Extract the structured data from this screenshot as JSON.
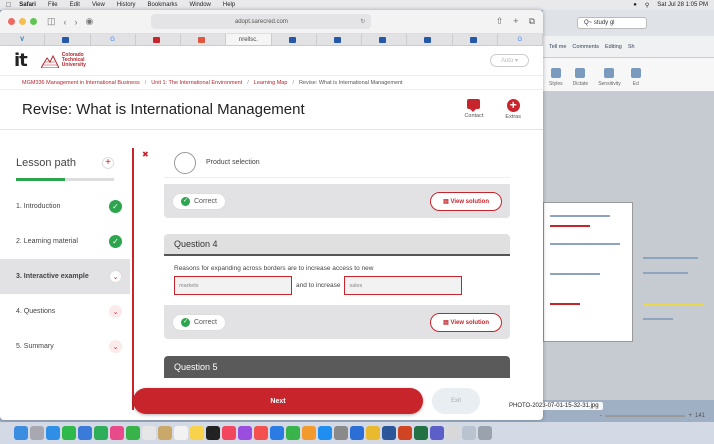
{
  "menubar": {
    "app": "Safari",
    "items": [
      "File",
      "Edit",
      "View",
      "History",
      "Bookmarks",
      "Window",
      "Help"
    ],
    "clock": "Sat Jul 28  1:05 PM"
  },
  "browser": {
    "url": "adopt.sarecred.com",
    "tabs": [
      "V",
      "",
      "G",
      "",
      "",
      "nrellsc.",
      "",
      "",
      "",
      "",
      "",
      "G"
    ]
  },
  "site": {
    "logo": "it",
    "university_name": "Colorado Technical University",
    "language_select": "Auto"
  },
  "breadcrumb": [
    "MGM336 Management in International Business",
    "Unit 1: The International Environment",
    "Learning Map",
    "Revise: What is International Management"
  ],
  "page": {
    "title": "Revise: What is International Management",
    "actions": {
      "contact": "Contact",
      "extras": "Extras"
    }
  },
  "lesson_path": {
    "title": "Lesson path",
    "progress_percent": 50,
    "items": [
      {
        "label": "1. Introduction",
        "state": "done"
      },
      {
        "label": "2. Learning material",
        "state": "done"
      },
      {
        "label": "3. Interactive example",
        "state": "current"
      },
      {
        "label": "4. Questions",
        "state": "open"
      },
      {
        "label": "5. Summary",
        "state": "open"
      }
    ]
  },
  "questions": {
    "prev": {
      "option_label": "Product selection",
      "result": "Correct",
      "view_solution": "View solution"
    },
    "q4": {
      "header": "Question 4",
      "text": "Reasons for expanding across borders are to increase access to new",
      "blank1": "markets",
      "middle": "and to increase",
      "blank2": "sales",
      "result": "Correct",
      "view_solution": "View solution"
    },
    "q5": {
      "header": "Question 5"
    }
  },
  "buttons": {
    "next": "Next",
    "exit": "Exit"
  },
  "word": {
    "search": "Q~ study gl",
    "ribbon": [
      "Tell me",
      "Comments",
      "Editing",
      "Sh"
    ],
    "tools": [
      "Styles",
      "Dictate",
      "Sensitivity",
      "Ed"
    ]
  },
  "photo_label": "PHOTO-2023-07-01-15-32-31.jpg",
  "zoom": {
    "minus": "-",
    "plus": "+",
    "value": "141"
  },
  "colors": {
    "accent": "#c8242b",
    "success": "#2da44e"
  }
}
